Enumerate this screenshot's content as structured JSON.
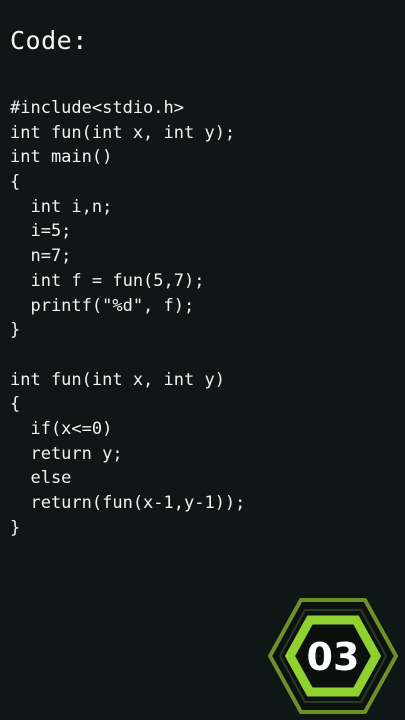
{
  "header": {
    "title": "Code:"
  },
  "code": {
    "lines": [
      "#include<stdio.h>",
      "int fun(int x, int y);",
      "int main()",
      "{",
      "  int i,n;",
      "  i=5;",
      "  n=7;",
      "  int f = fun(5,7);",
      "  printf(\"%d\", f);",
      "}",
      "",
      "int fun(int x, int y)",
      "{",
      "  if(x<=0)",
      "  return y;",
      "  else",
      "  return(fun(x-1,y-1));",
      "}"
    ]
  },
  "badge": {
    "number": "03",
    "icon": "hexagon-badge-icon",
    "colors": {
      "accent": "#8fd12e",
      "outer_ring": "#6e8f2a",
      "dark": "#0c1210",
      "text": "#ffffff"
    }
  },
  "colors": {
    "background": "#0e1715",
    "text": "#f2f4f3"
  }
}
